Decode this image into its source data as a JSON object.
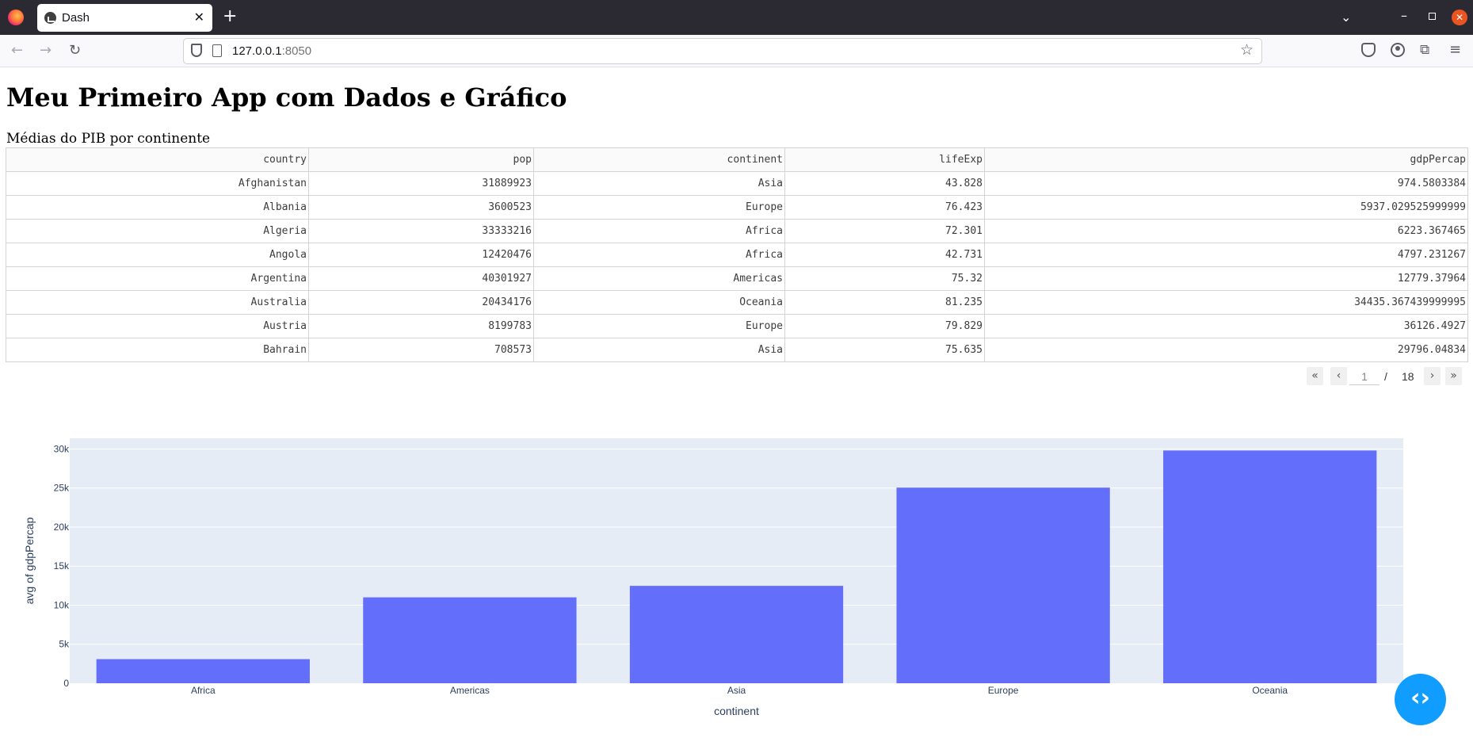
{
  "browser": {
    "tab_title": "Dash",
    "url_host": "127.0.0.1",
    "url_port": ":8050"
  },
  "page": {
    "title": "Meu Primeiro App com Dados e Gráfico",
    "subtitle": "Médias do PIB por continente"
  },
  "table": {
    "columns": [
      "country",
      "pop",
      "continent",
      "lifeExp",
      "gdpPercap"
    ],
    "rows": [
      [
        "Afghanistan",
        "31889923",
        "Asia",
        "43.828",
        "974.5803384"
      ],
      [
        "Albania",
        "3600523",
        "Europe",
        "76.423",
        "5937.029525999999"
      ],
      [
        "Algeria",
        "33333216",
        "Africa",
        "72.301",
        "6223.367465"
      ],
      [
        "Angola",
        "12420476",
        "Africa",
        "42.731",
        "4797.231267"
      ],
      [
        "Argentina",
        "40301927",
        "Americas",
        "75.32",
        "12779.37964"
      ],
      [
        "Australia",
        "20434176",
        "Oceania",
        "81.235",
        "34435.367439999995"
      ],
      [
        "Austria",
        "8199783",
        "Europe",
        "79.829",
        "36126.4927"
      ],
      [
        "Bahrain",
        "708573",
        "Asia",
        "75.635",
        "29796.04834"
      ]
    ]
  },
  "pagination": {
    "current_page": "1",
    "separator": "/",
    "total_pages": "18"
  },
  "chart_data": {
    "type": "bar",
    "categories": [
      "Africa",
      "Americas",
      "Asia",
      "Europe",
      "Oceania"
    ],
    "values": [
      3089,
      11003,
      12473,
      25055,
      29810
    ],
    "xlabel": "continent",
    "ylabel": "avg of gdpPercap",
    "ylim": [
      0,
      31368
    ],
    "yticks": [
      0,
      5000,
      10000,
      15000,
      20000,
      25000,
      30000
    ],
    "ytick_labels": [
      "0",
      "5k",
      "10k",
      "15k",
      "20k",
      "25k",
      "30k"
    ],
    "grid": true,
    "bar_color": "#636efa",
    "plot_bg": "#e5ecf6"
  }
}
